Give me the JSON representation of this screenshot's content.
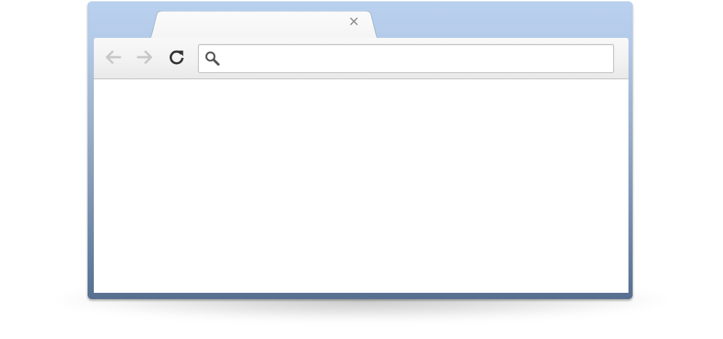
{
  "browser": {
    "tab": {
      "title": "",
      "close_icon": "close-icon"
    },
    "toolbar": {
      "back_icon": "arrow-left-icon",
      "back_enabled": false,
      "forward_icon": "arrow-right-icon",
      "forward_enabled": false,
      "reload_icon": "reload-icon"
    },
    "omnibox": {
      "icon": "search-icon",
      "value": "",
      "placeholder": ""
    },
    "page": {
      "content": ""
    }
  },
  "colors": {
    "frame_top": "#b9d0ee",
    "frame_bottom": "#566f90",
    "toolbar": "#f1f1f1",
    "disabled_icon": "#c8c8c8",
    "active_icon": "#333333",
    "close_icon": "#8a8a8a"
  }
}
